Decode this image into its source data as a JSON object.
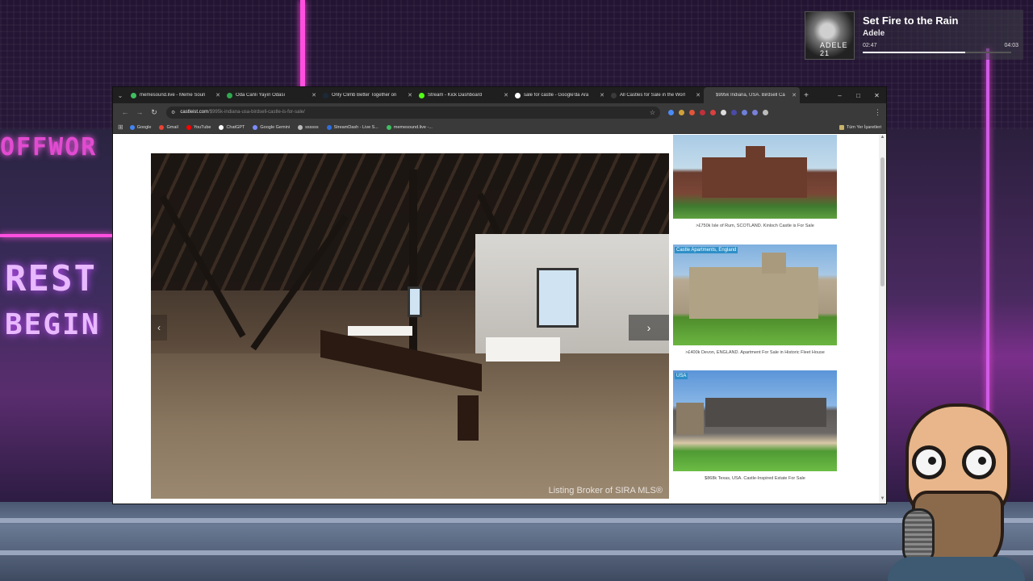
{
  "now_playing": {
    "title": "Set Fire to the Rain",
    "artist": "Adele",
    "album_art_label": "ADELE 21",
    "time_current": "02:47",
    "time_total": "04:03",
    "progress": 0.69
  },
  "background": {
    "sign_top": "OFFWOR",
    "sign_middle": "REST",
    "sign_bottom": "BEGIN"
  },
  "browser": {
    "tabs": [
      {
        "label": "memesound.live - Meme Soun",
        "favicon_color": "#3fbf5f",
        "active": false
      },
      {
        "label": "Oda Canlı Yayın Odası",
        "favicon_color": "#2fa84f",
        "active": false
      },
      {
        "label": "Only Climb Better Together on",
        "favicon_color": "#1b2838",
        "active": false
      },
      {
        "label": "Stream - Kick Dashboard",
        "favicon_color": "#53fc18",
        "active": false
      },
      {
        "label": "sale for castle - Google'da Ara",
        "favicon_color": "#ffffff",
        "active": false
      },
      {
        "label": "All Castles for Sale in the Worl",
        "favicon_color": "#3a3a3a",
        "active": false
      },
      {
        "label": "$995k Indiana, USA. Birdsell Ca",
        "favicon_color": "#3a3a3a",
        "active": true
      }
    ],
    "new_tab": "+",
    "window_controls": [
      "–",
      "□",
      "✕"
    ],
    "address": {
      "host": "castleist.com",
      "path": "/$995k-indiana-usa-birdsell-castle-is-for-sale/"
    },
    "bookmarks": [
      {
        "label": "Google",
        "color": "#4285f4"
      },
      {
        "label": "Gmail",
        "color": "#ea4335"
      },
      {
        "label": "YouTube",
        "color": "#ff0000"
      },
      {
        "label": "ChatGPT",
        "color": "#ffffff"
      },
      {
        "label": "Google Gemini",
        "color": "#7b8cff"
      },
      {
        "label": "ssssss",
        "color": "#bbbbbb"
      },
      {
        "label": "StreamDash - Live S...",
        "color": "#2f6fdd"
      },
      {
        "label": "memesound.live -...",
        "color": "#3fbf5f"
      }
    ],
    "bookmarks_right": "Tüm Yer İşaretleri"
  },
  "page": {
    "hero_watermark": "Listing Broker of SIRA MLS®",
    "next_arrow": "›",
    "listings": [
      {
        "tag": "",
        "caption": ">£750k Isle of Rum, SCOTLAND. Kinloch Castle is For Sale"
      },
      {
        "tag": "Castle Apartments, England",
        "caption": ">£400k Devon, ENGLAND. Apartment For Sale in Historic Fleet House"
      },
      {
        "tag": "USA",
        "caption": "$868k Texas, USA. Castle-Inspired Estate For Sale"
      }
    ]
  }
}
